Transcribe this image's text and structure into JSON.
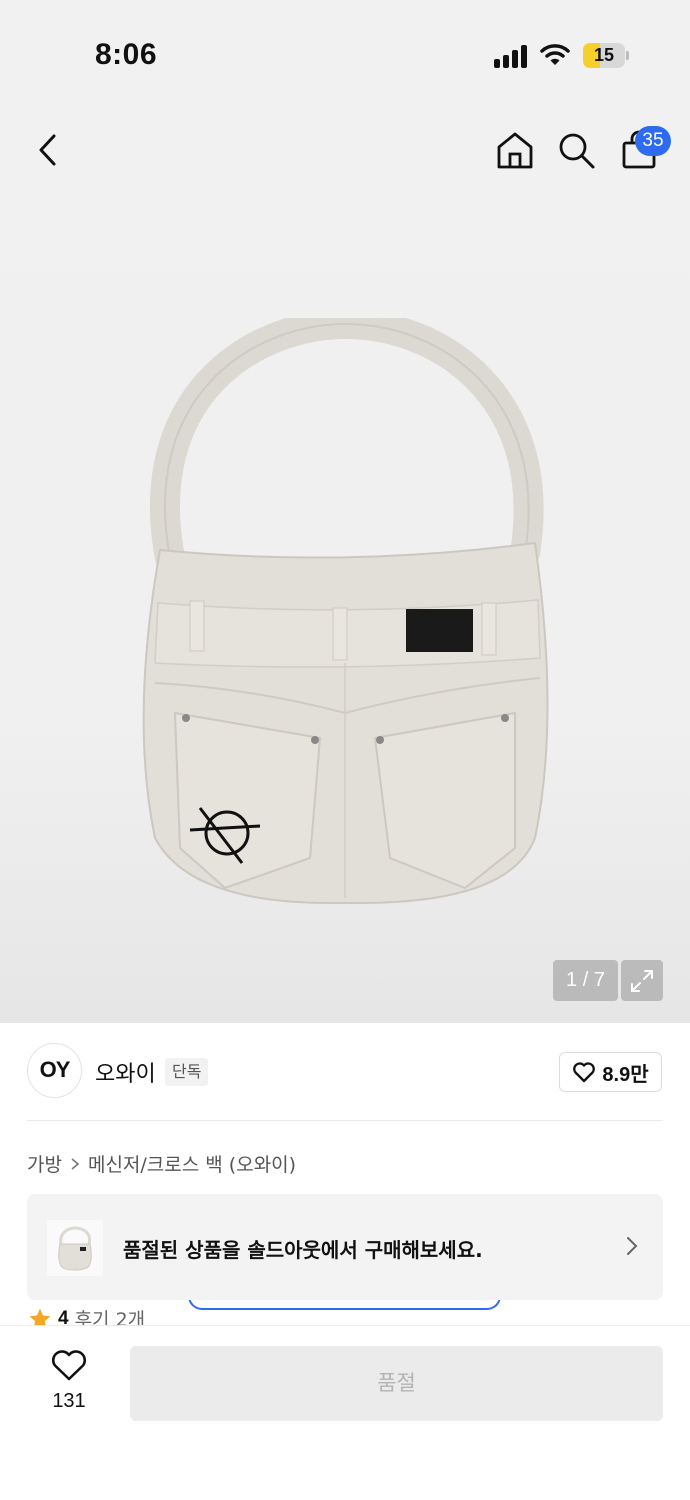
{
  "status_bar": {
    "time": "8:06",
    "battery_level": "15"
  },
  "nav": {
    "cart_badge": "35"
  },
  "gallery": {
    "pager": "1 / 7"
  },
  "brand": {
    "logo_text": "OY",
    "name": "오와이",
    "exclusive_label": "단독",
    "like_count": "8.9만"
  },
  "breadcrumb": {
    "category": "가방",
    "subcategory": "메신저/크로스 백 (오와이)"
  },
  "notice": {
    "text": "품절된 상품을 솔드아웃에서 구매해보세요."
  },
  "review": {
    "score": "4",
    "review_label": "후기 2개"
  },
  "bottom_bar": {
    "wish_count": "131",
    "buy_button_label": "품절"
  },
  "colors": {
    "accent": "#2e6bf0",
    "battery": "#f6cf2a",
    "star": "#f5a623",
    "disabled_button": "#ebebeb"
  }
}
